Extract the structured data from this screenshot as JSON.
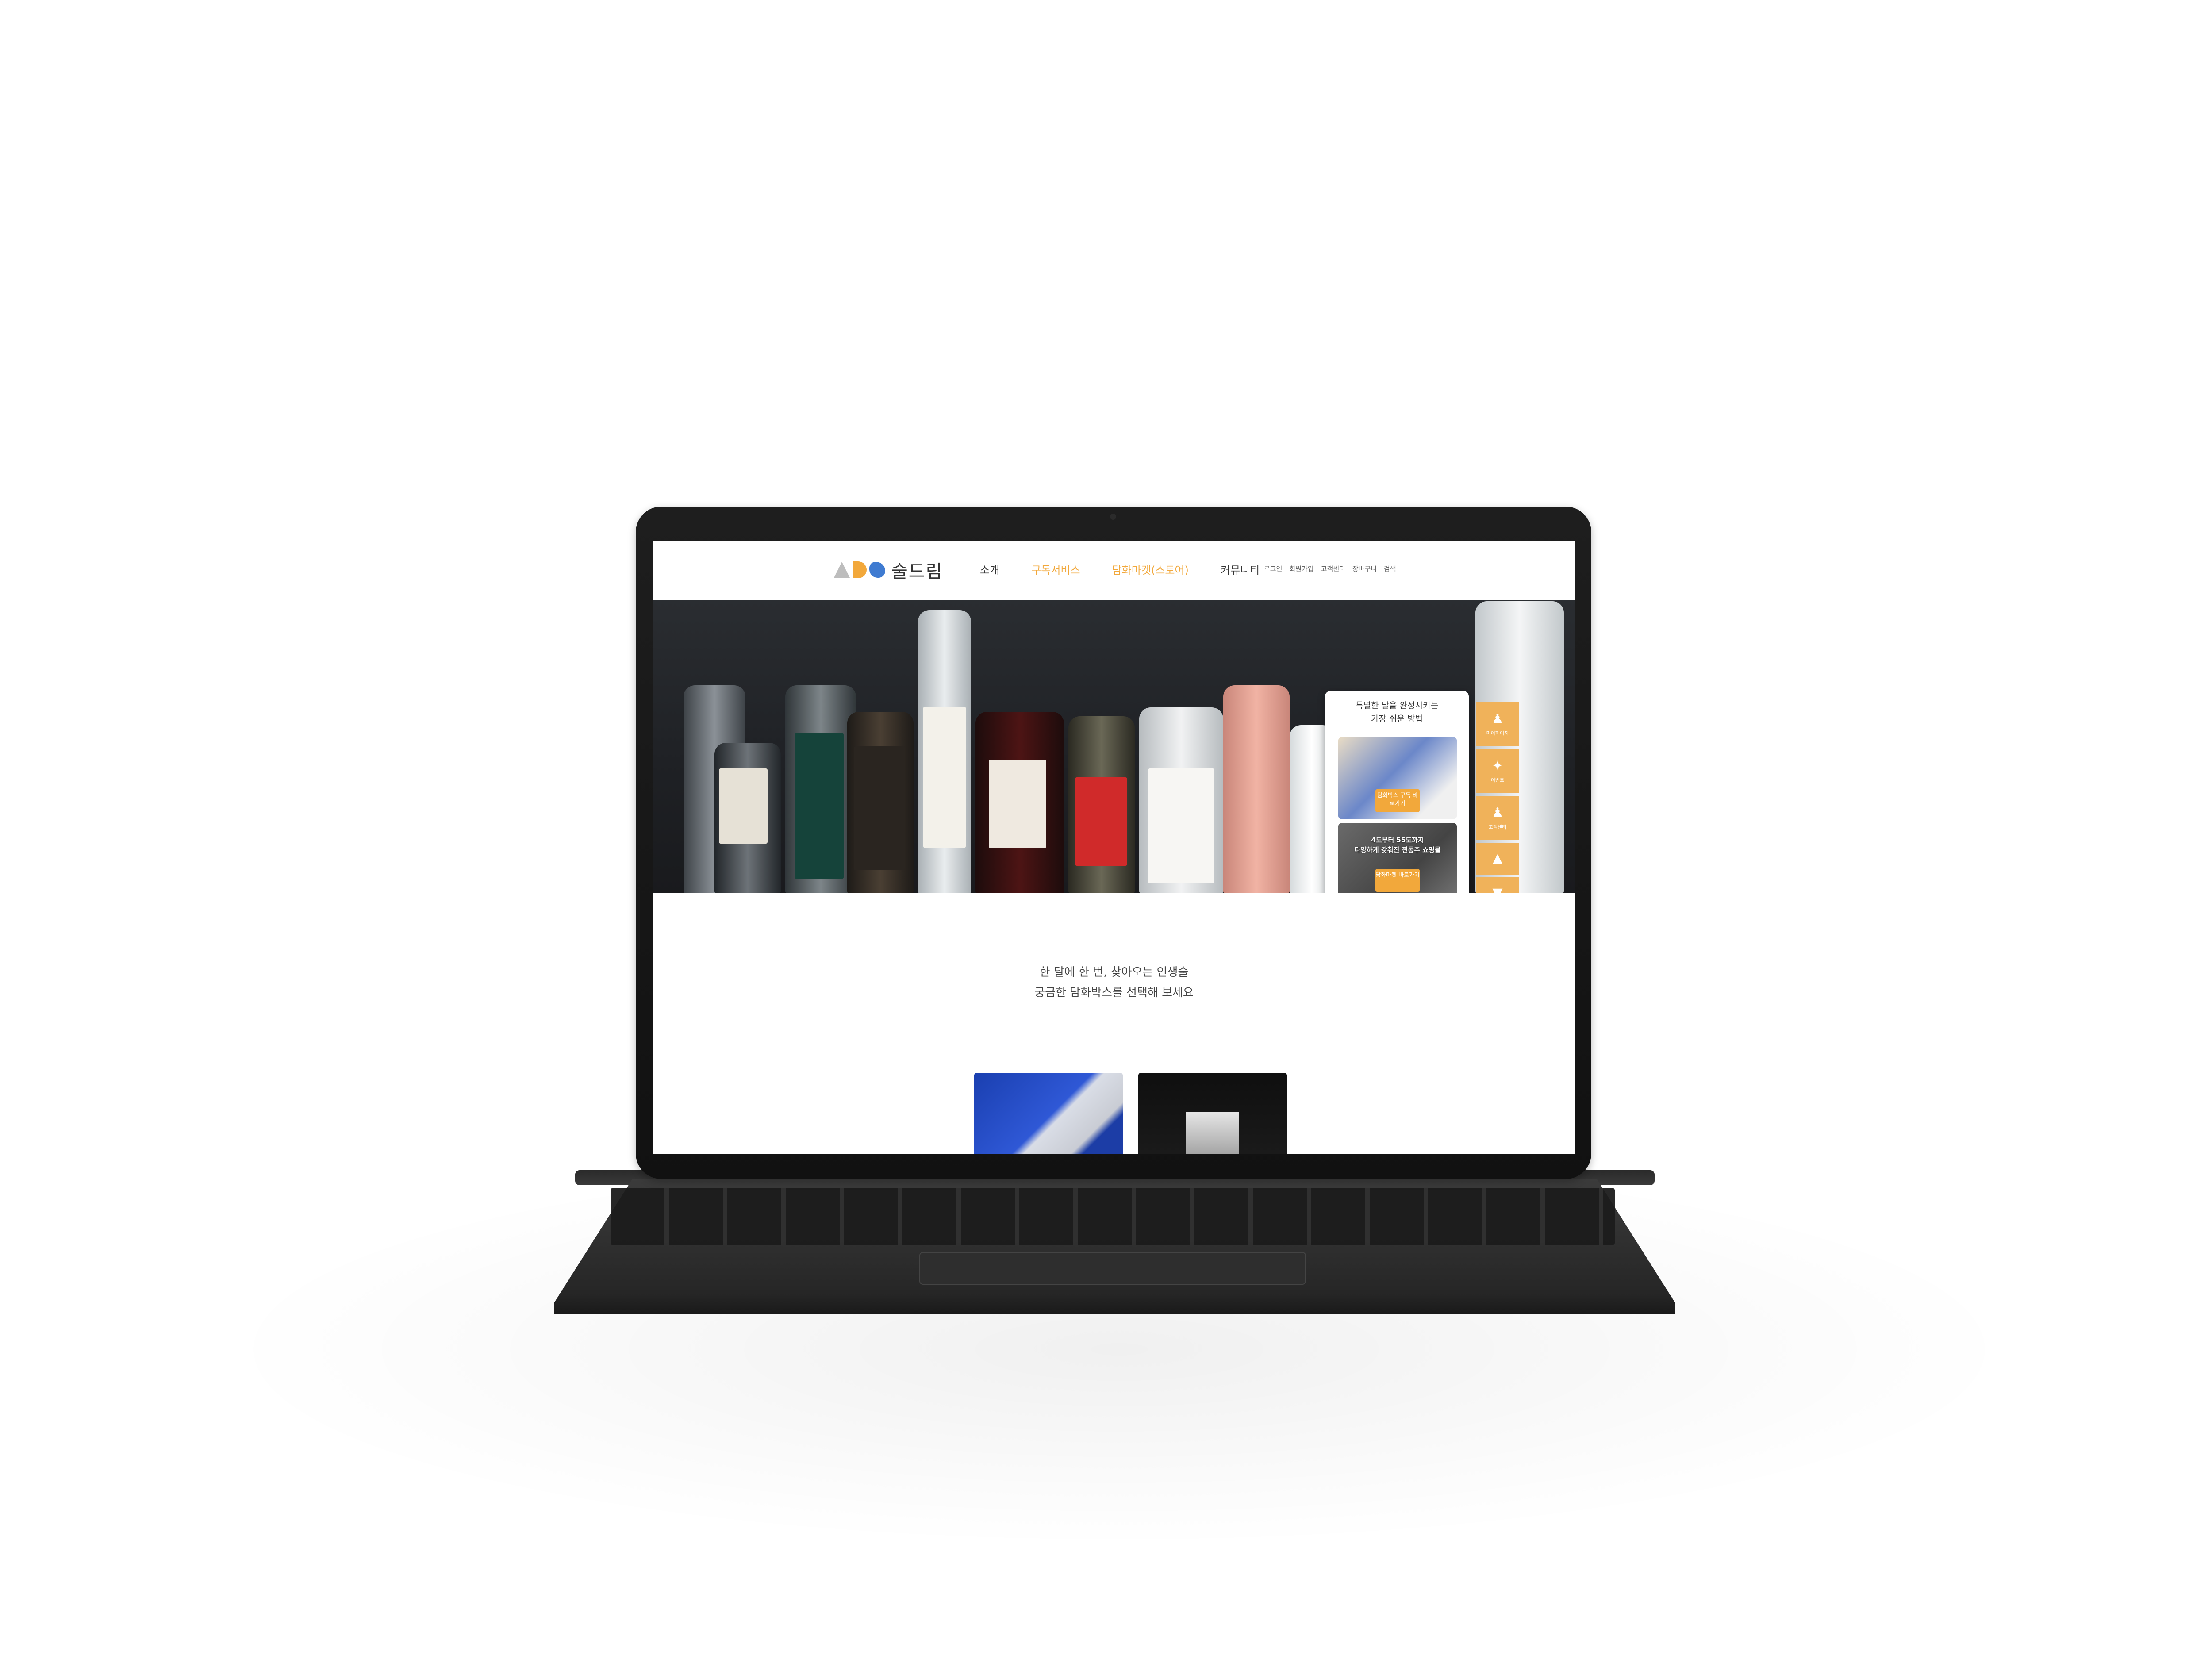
{
  "header": {
    "logo_text": "술드림",
    "nav": [
      {
        "label": "소개"
      },
      {
        "label": "구독서비스"
      },
      {
        "label": "담화마켓(스토어)"
      },
      {
        "label": "커뮤니티"
      }
    ],
    "utility": [
      {
        "label": "로그인"
      },
      {
        "label": "회원가입"
      },
      {
        "label": "고객센터"
      },
      {
        "label": "장바구니"
      },
      {
        "label": "검색"
      }
    ]
  },
  "popup": {
    "title_line1": "특별한 날을 완성시키는",
    "title_line2": "가장 쉬운 방법",
    "card1": {
      "button": "담화박스 구독 바로가기"
    },
    "card2": {
      "text_line1": "4도부터 55도까지",
      "text_line2": "다양하게 갖춰진 전통주 쇼핑몰",
      "button": "담화마켓 바로가기"
    }
  },
  "sidebar": {
    "items": [
      {
        "label": "마이페이지",
        "icon": "user-icon"
      },
      {
        "label": "이벤트",
        "icon": "party-icon"
      },
      {
        "label": "고객센터",
        "icon": "support-icon"
      }
    ],
    "up_icon": "arrow-up-icon",
    "down_icon": "arrow-down-icon"
  },
  "section": {
    "line1": "한 달에 한 번, 찾아오는 인생술",
    "line2": "궁금한 담화박스를 선택해 보세요"
  },
  "colors": {
    "accent": "#f2a83b",
    "sidebar": "#f0b25a"
  }
}
